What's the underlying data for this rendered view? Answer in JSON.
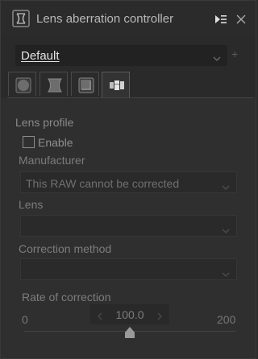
{
  "window": {
    "title": "Lens aberration controller",
    "pin_icon": "pin-panel-icon",
    "close_icon": "close-icon"
  },
  "preset": {
    "selected": "Default",
    "add_symbol": "+"
  },
  "tabs": [
    {
      "name": "vignette",
      "icon": "vignette-icon",
      "active": false
    },
    {
      "name": "distortion",
      "icon": "distortion-icon",
      "active": false
    },
    {
      "name": "chromatic",
      "icon": "chromatic-aberration-icon",
      "active": false
    },
    {
      "name": "lens-profile",
      "icon": "lens-icon",
      "active": true
    }
  ],
  "lens_profile": {
    "section_title": "Lens profile",
    "enable_label": "Enable",
    "enable_checked": false,
    "manufacturer_label": "Manufacturer",
    "manufacturer_value": "This RAW cannot be corrected",
    "lens_label": "Lens",
    "lens_value": "",
    "method_label": "Correction method",
    "method_value": ""
  },
  "rate": {
    "label": "Rate of correction",
    "min": "0",
    "max": "200",
    "value": "100.0",
    "fraction": 0.5
  },
  "colors": {
    "background": "#2b2b2b",
    "content": "#2f2f2f",
    "text_dim": "#7c7c7c"
  }
}
